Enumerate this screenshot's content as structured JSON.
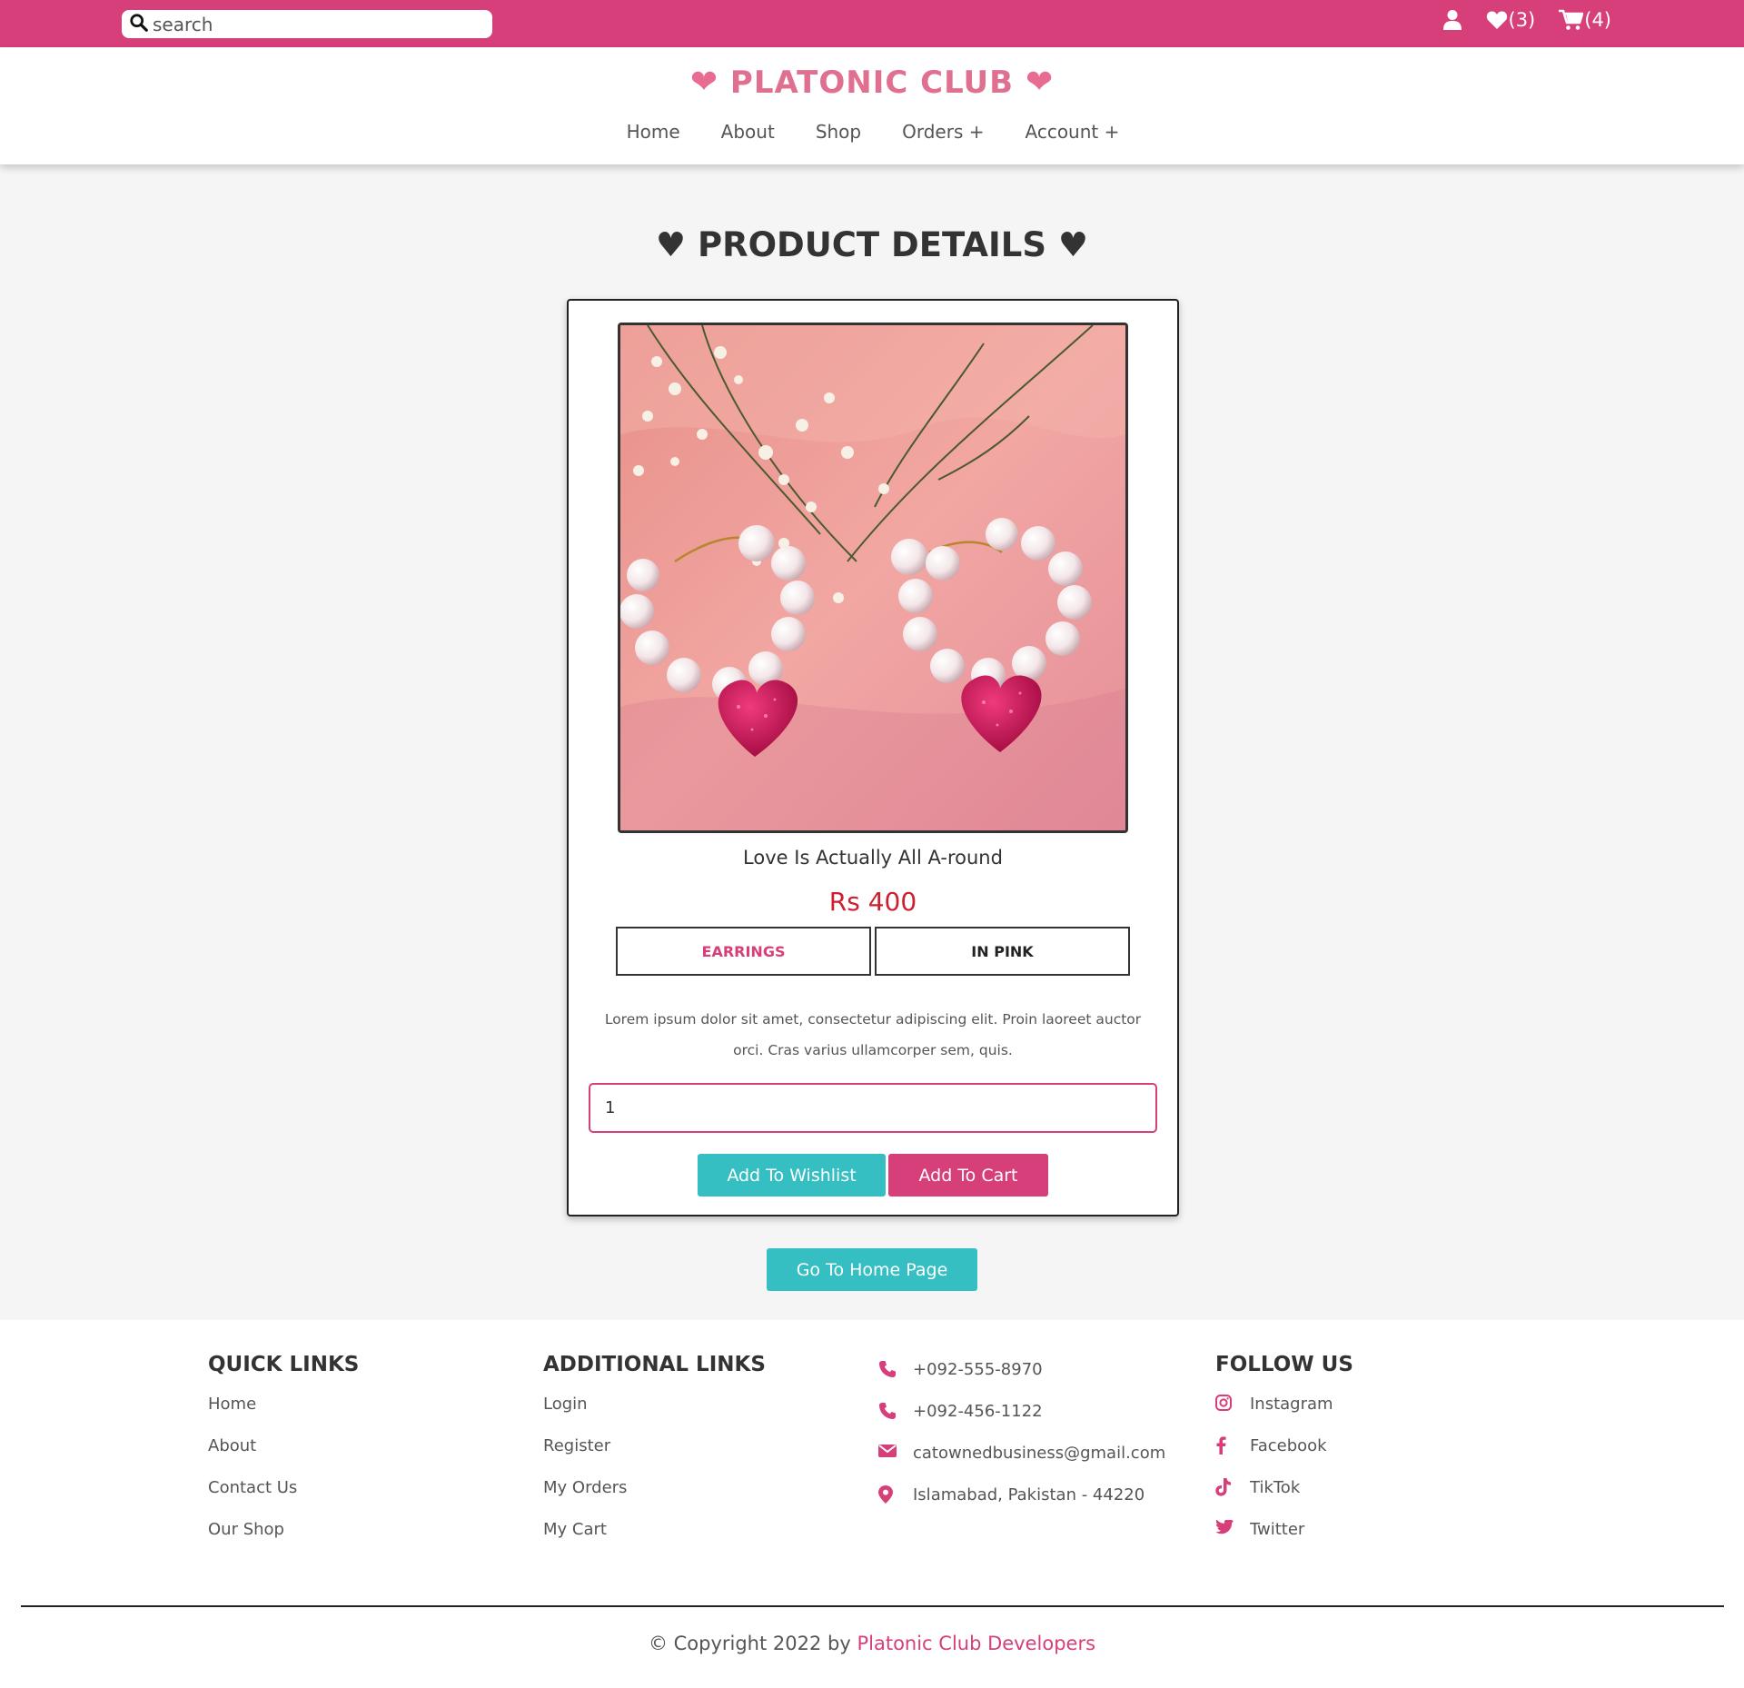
{
  "search": {
    "placeholder": "search"
  },
  "topbar": {
    "wishlist_count": "(3)",
    "cart_count": "(4)"
  },
  "brand": {
    "name": "PLATONIC CLUB",
    "left_heart": "❤",
    "right_heart": "❤"
  },
  "nav": {
    "items": [
      "Home",
      "About",
      "Shop",
      "Orders +",
      "Account +"
    ]
  },
  "page": {
    "title": "♥ PRODUCT DETAILS ♥"
  },
  "product": {
    "name": "Love Is Actually All A-round",
    "price": "Rs 400",
    "category": "EARRINGS",
    "color": "IN PINK",
    "description": "Lorem ipsum dolor sit amet, consectetur adipiscing elit. Proin laoreet auctor orci. Cras varius ullamcorper sem, quis.",
    "quantity": "1",
    "wishlist_label": "Add To Wishlist",
    "cart_label": "Add To Cart"
  },
  "home_button": "Go To Home Page",
  "footer": {
    "quick_links": {
      "title": "QUICK LINKS",
      "items": [
        "Home",
        "About",
        "Contact Us",
        "Our Shop"
      ]
    },
    "additional_links": {
      "title": "ADDITIONAL LINKS",
      "items": [
        "Login",
        "Register",
        "My Orders",
        "My Cart"
      ]
    },
    "contact": {
      "items": [
        "+092-555-8970",
        "+092-456-1122",
        "catownedbusiness@gmail.com",
        "Islamabad, Pakistan - 44220"
      ]
    },
    "follow": {
      "title": "FOLLOW US",
      "items": [
        "Instagram",
        "Facebook",
        "TikTok",
        "Twitter"
      ]
    },
    "copyright": "© Copyright 2022 by",
    "copyright_brand": "Platonic Club Developers"
  },
  "colors": {
    "accent": "#d63f7a",
    "teal": "#35bfc3",
    "price": "#cc1f2f",
    "logo": "#e0708f"
  },
  "icons": [
    "search-icon",
    "user-icon",
    "heart-icon",
    "cart-icon",
    "phone-icon",
    "mail-icon",
    "location-icon",
    "instagram-icon",
    "facebook-icon",
    "tiktok-icon",
    "twitter-icon"
  ]
}
